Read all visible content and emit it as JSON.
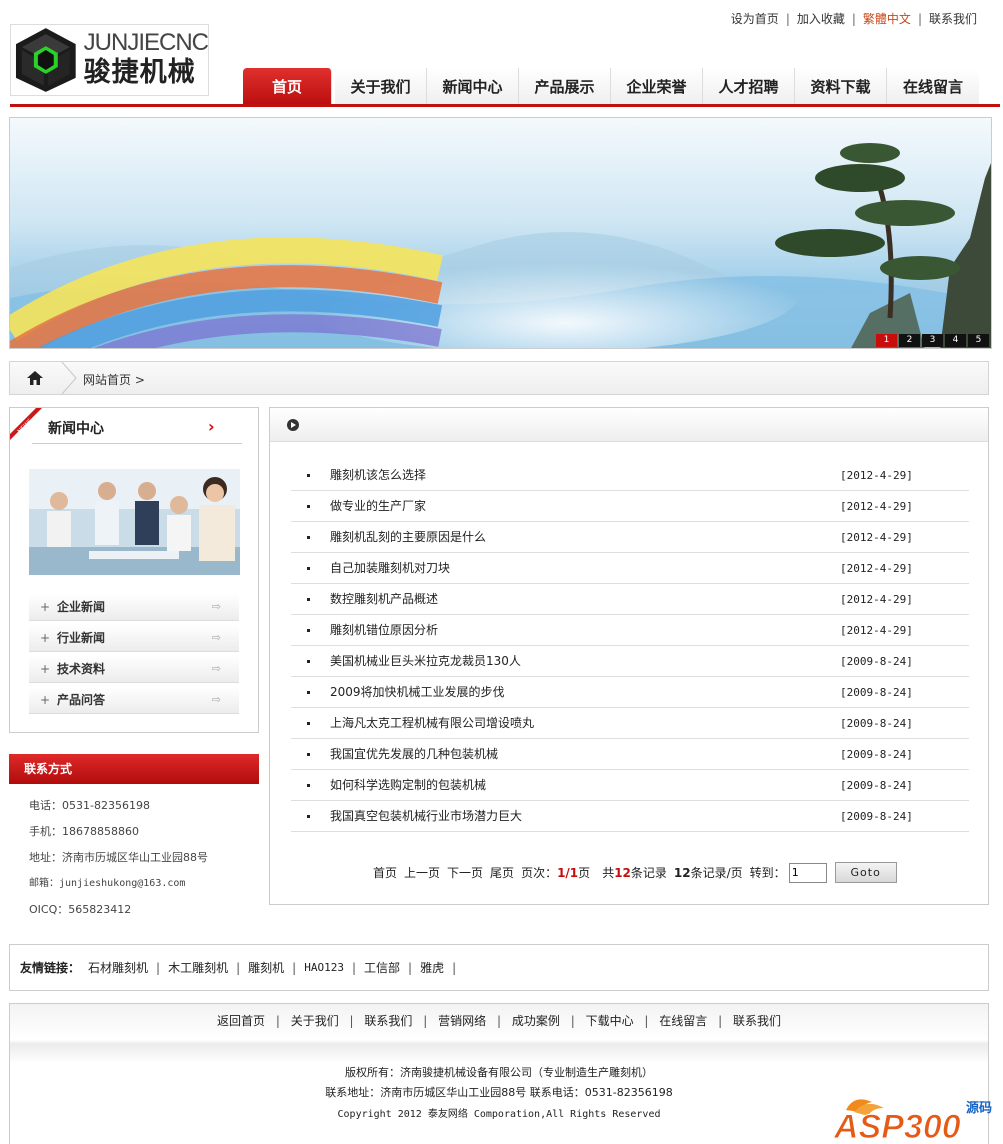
{
  "toplinks": {
    "home": "设为首页",
    "favorite": "加入收藏",
    "traditional": "繁體中文",
    "contact": "联系我们",
    "sep": "|"
  },
  "logo": {
    "en": "JUNJIECNC",
    "cn": "骏捷机械"
  },
  "nav": [
    "首页",
    "关于我们",
    "新闻中心",
    "产品展示",
    "企业荣誉",
    "人才招聘",
    "资料下载",
    "在线留言"
  ],
  "banner": {
    "pages": [
      "1",
      "2",
      "3",
      "4",
      "5"
    ],
    "active_page": "1"
  },
  "breadcrumb": {
    "text": "网站首页 >"
  },
  "sidebar": {
    "title": "新闻中心",
    "arrow": "›",
    "ribbon_text": "NEWS",
    "items": [
      "企业新闻",
      "行业新闻",
      "技术资料",
      "产品问答"
    ],
    "plus": "+",
    "item_icon": "⇨"
  },
  "contact": {
    "title": "联系方式",
    "phone": "电话：0531-82356198",
    "mobile": "手机：18678858860",
    "address": "地址：济南市历城区华山工业园88号",
    "email": "邮箱：junjieshukong@163.com",
    "oicq": "OICQ：565823412"
  },
  "news": [
    {
      "title": "雕刻机该怎么选择",
      "date": "[2012-4-29]"
    },
    {
      "title": "做专业的生产厂家",
      "date": "[2012-4-29]"
    },
    {
      "title": "雕刻机乱刻的主要原因是什么",
      "date": "[2012-4-29]"
    },
    {
      "title": "自己加装雕刻机对刀块",
      "date": "[2012-4-29]"
    },
    {
      "title": "数控雕刻机产品概述",
      "date": "[2012-4-29]"
    },
    {
      "title": "雕刻机错位原因分析",
      "date": "[2012-4-29]"
    },
    {
      "title": "美国机械业巨头米拉克龙裁员130人",
      "date": "[2009-8-24]"
    },
    {
      "title": "2009将加快机械工业发展的步伐",
      "date": "[2009-8-24]"
    },
    {
      "title": "上海凡太克工程机械有限公司增设喷丸",
      "date": "[2009-8-24]"
    },
    {
      "title": "我国宜优先发展的几种包装机械",
      "date": "[2009-8-24]"
    },
    {
      "title": "如何科学选购定制的包装机械",
      "date": "[2009-8-24]"
    },
    {
      "title": "我国真空包装机械行业市场潜力巨大",
      "date": "[2009-8-24]"
    }
  ],
  "pagination": {
    "first": "首页",
    "prev": "上一页",
    "next": "下一页",
    "last": "尾页",
    "page_label": "页次：",
    "page_value": "1/1",
    "page_unit": "页",
    "total_pre": "共",
    "total": "12",
    "total_post": "条记录",
    "per_page": "12",
    "per_post": "条记录/页",
    "goto_label": "转到：",
    "goto_value": "1",
    "goto_button": "Goto"
  },
  "friend_links": {
    "label": "友情链接：",
    "items": [
      "石材雕刻机",
      "木工雕刻机",
      "雕刻机",
      "HAO123",
      "工信部",
      "雅虎"
    ],
    "sep": "|"
  },
  "footer": {
    "links": [
      "返回首页",
      "关于我们",
      "联系我们",
      "营销网络",
      "成功案例",
      "下载中心",
      "在线留言",
      "联系我们"
    ],
    "sep": "|",
    "copyright": "版权所有：济南骏捷机械设备有限公司（专业制造生产雕刻机）",
    "address": "联系地址：济南市历城区华山工业园88号 联系电话：0531-82356198",
    "copyright_en": "Copyright 2012 泰友网络 Comporation,All Rights Reserved"
  },
  "watermark": {
    "text": "ASP300",
    "sub": "源码"
  },
  "colors": {
    "brand_red": "#c10f0f",
    "accent_orange": "#c8471b"
  }
}
